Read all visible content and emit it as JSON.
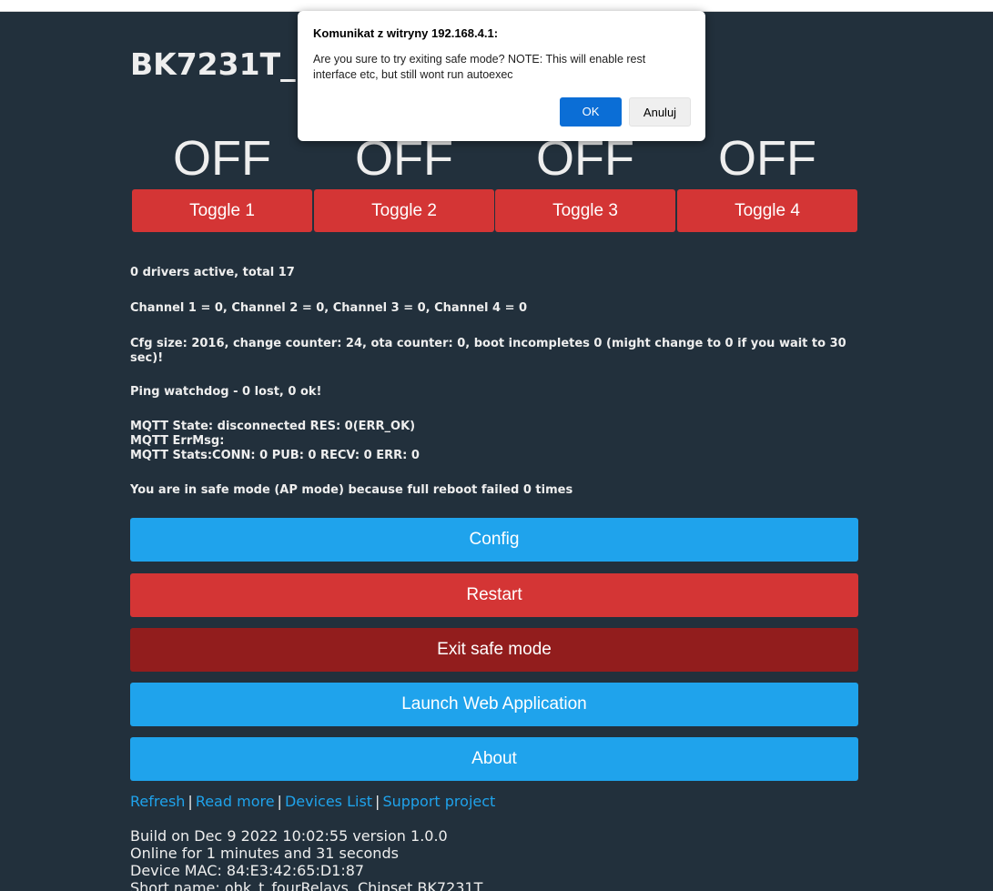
{
  "dialog": {
    "title": "Komunikat z witryny 192.168.4.1:",
    "message": "Are you sure to try exiting safe mode? NOTE: This will enable rest interface etc, but still wont run autoexec",
    "ok_label": "OK",
    "cancel_label": "Anuluj"
  },
  "header": {
    "title": "BK7231T_"
  },
  "relays": [
    {
      "state": "OFF",
      "label": "Toggle 1"
    },
    {
      "state": "OFF",
      "label": "Toggle 2"
    },
    {
      "state": "OFF",
      "label": "Toggle 3"
    },
    {
      "state": "OFF",
      "label": "Toggle 4"
    }
  ],
  "status": {
    "drivers": "0 drivers active, total 17",
    "channels": "Channel 1 = 0, Channel 2 = 0, Channel 3 = 0, Channel 4 = 0",
    "cfg": "Cfg size: 2016, change counter: 24, ota counter: 0, boot incompletes 0 (might change to 0 if you wait to 30 sec)!",
    "ping": "Ping watchdog - 0 lost, 0 ok!",
    "mqtt_state": "MQTT State: disconnected RES: 0(ERR_OK)",
    "mqtt_errmsg": "MQTT ErrMsg:",
    "mqtt_stats": "MQTT Stats:CONN: 0 PUB: 0 RECV: 0 ERR: 0",
    "safe_mode": "You are in safe mode (AP mode) because full reboot failed 0 times"
  },
  "buttons": {
    "config": "Config",
    "restart": "Restart",
    "exit_safe_mode": "Exit safe mode",
    "launch_web_app": "Launch Web Application",
    "about": "About"
  },
  "links": {
    "refresh": "Refresh",
    "read_more": "Read more",
    "devices_list": "Devices List",
    "support_project": "Support project",
    "separator": "|"
  },
  "build_info": {
    "build": "Build on Dec 9 2022 10:02:55 version 1.0.0",
    "online": "Online for 1 minutes and 31 seconds",
    "mac": "Device MAC: 84:E3:42:65:D1:87",
    "short_name": "Short name: obk_t_fourRelays, Chipset BK7231T"
  },
  "colors": {
    "background": "#22303c",
    "blue_button": "#1fa3ec",
    "red_button": "#d43535",
    "dark_red_button": "#921d1d",
    "dialog_ok": "#0b6ed6"
  }
}
